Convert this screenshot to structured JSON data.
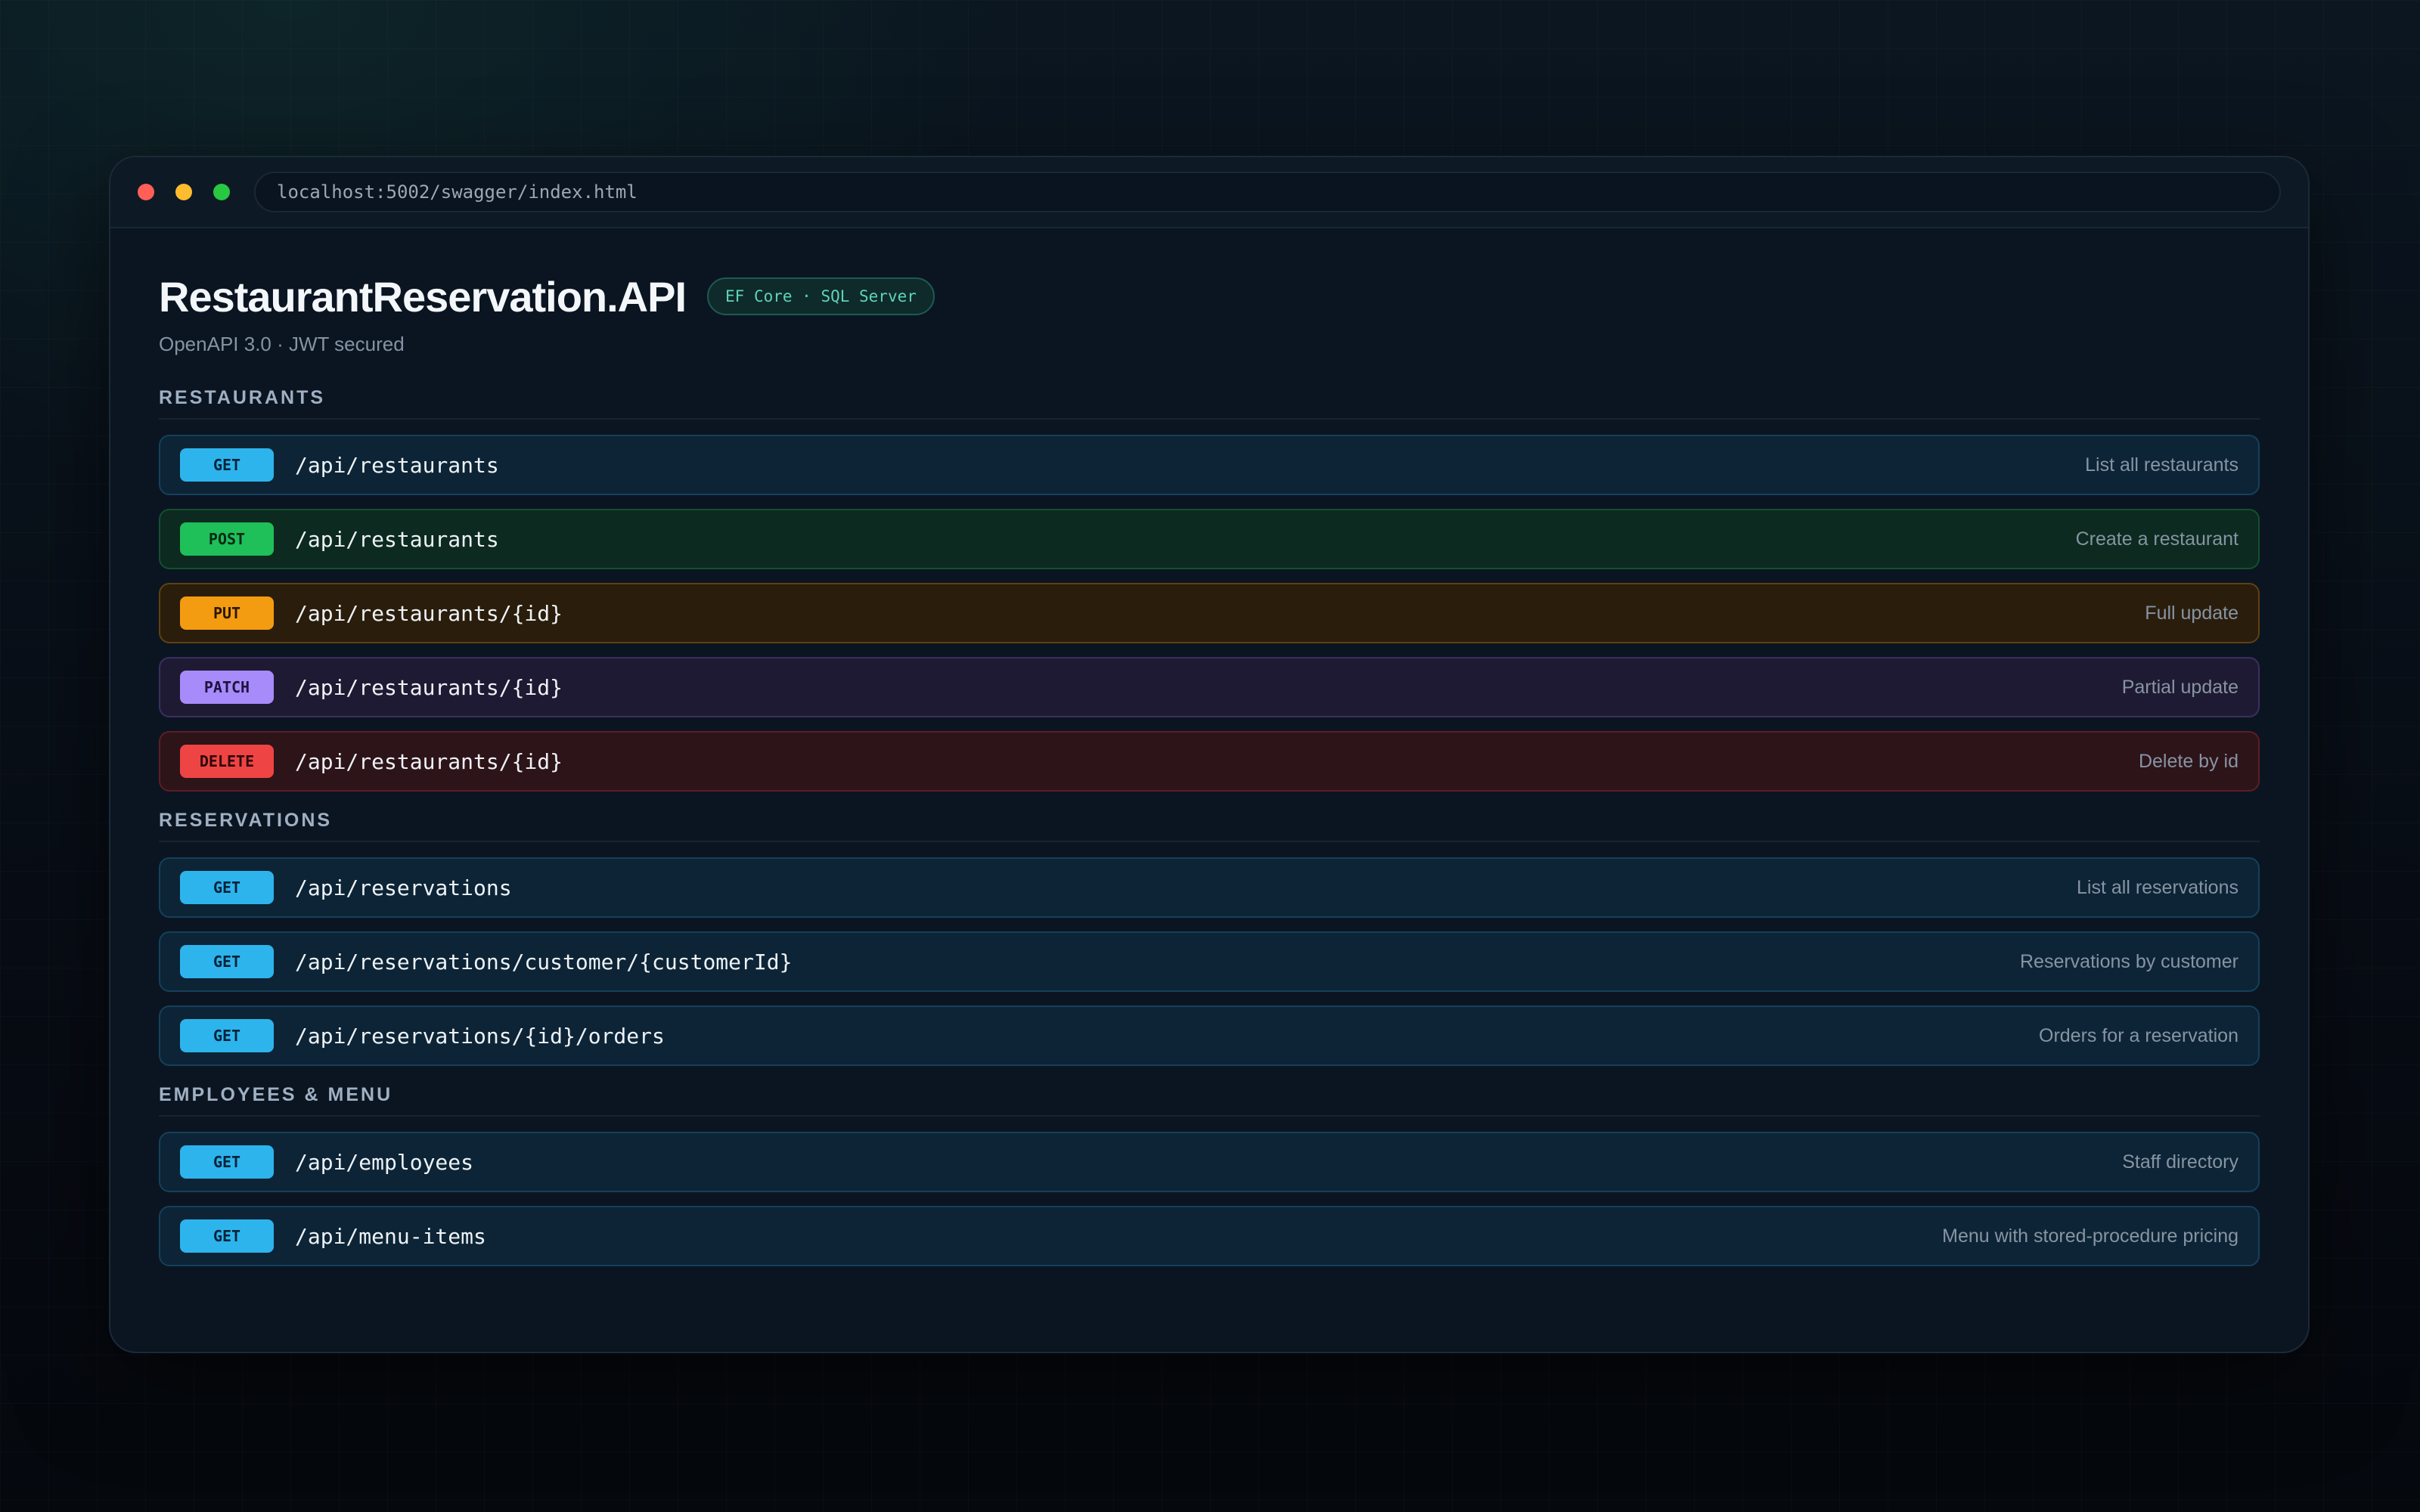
{
  "window": {
    "url": "localhost:5002/swagger/index.html"
  },
  "header": {
    "title": "RestaurantReservation.API",
    "badge": "EF Core · SQL Server",
    "subtitle": "OpenAPI 3.0 · JWT secured"
  },
  "sections": [
    {
      "title": "RESTAURANTS",
      "endpoints": [
        {
          "method": "GET",
          "path": "/api/restaurants",
          "description": "List all restaurants"
        },
        {
          "method": "POST",
          "path": "/api/restaurants",
          "description": "Create a restaurant"
        },
        {
          "method": "PUT",
          "path": "/api/restaurants/{id}",
          "description": "Full update"
        },
        {
          "method": "PATCH",
          "path": "/api/restaurants/{id}",
          "description": "Partial update"
        },
        {
          "method": "DELETE",
          "path": "/api/restaurants/{id}",
          "description": "Delete by id"
        }
      ]
    },
    {
      "title": "RESERVATIONS",
      "endpoints": [
        {
          "method": "GET",
          "path": "/api/reservations",
          "description": "List all reservations"
        },
        {
          "method": "GET",
          "path": "/api/reservations/customer/{customerId}",
          "description": "Reservations by customer"
        },
        {
          "method": "GET",
          "path": "/api/reservations/{id}/orders",
          "description": "Orders for a reservation"
        }
      ]
    },
    {
      "title": "EMPLOYEES & MENU",
      "endpoints": [
        {
          "method": "GET",
          "path": "/api/employees",
          "description": "Staff directory"
        },
        {
          "method": "GET",
          "path": "/api/menu-items",
          "description": "Menu with stored-procedure pricing"
        }
      ]
    }
  ],
  "colors": {
    "get": "#2db4ec",
    "post": "#1fbf5a",
    "put": "#f39c12",
    "patch": "#a78bfa",
    "delete": "#ef4444",
    "badge_text": "#5fd3b8"
  }
}
